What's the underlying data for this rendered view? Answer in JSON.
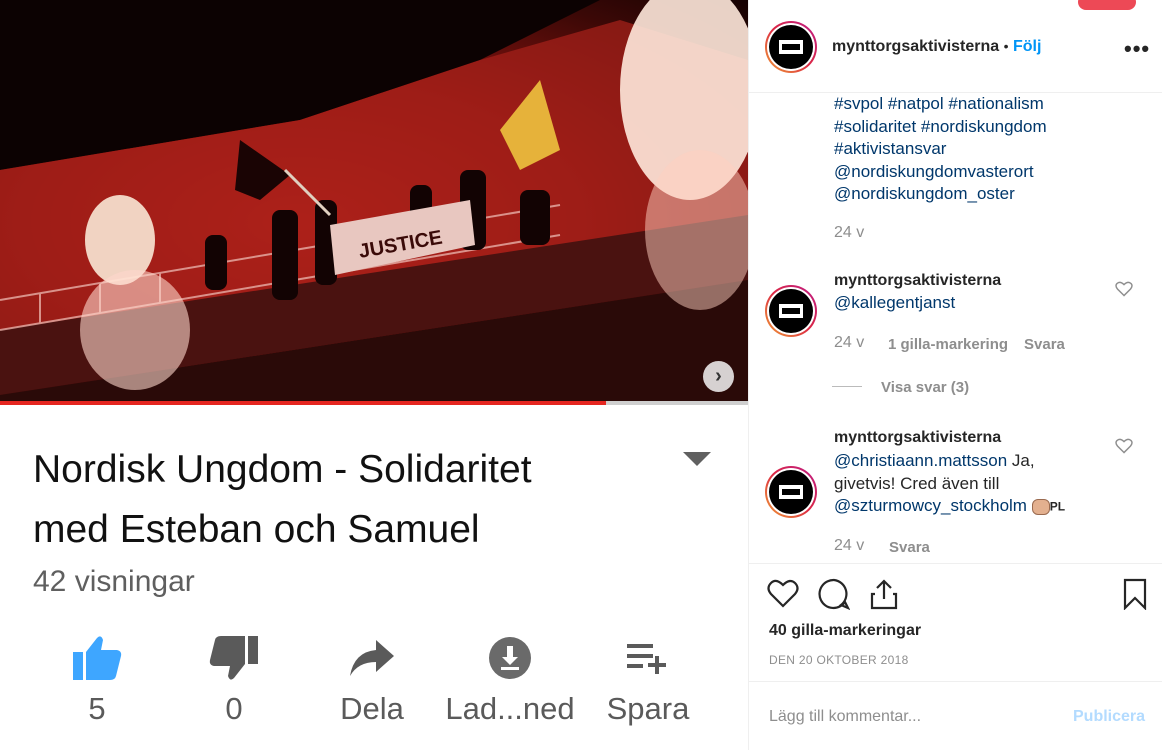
{
  "video": {
    "banner_text": "JUSTICE",
    "progress_fraction": 0.81,
    "next_label": "›"
  },
  "yt": {
    "title_line1": "Nordisk Ungdom - Solidaritet",
    "title_line2": "med Esteban och Samuel",
    "views": "42 visningar",
    "actions": [
      {
        "label": "5",
        "icon": "thumbs-up-icon"
      },
      {
        "label": "0",
        "icon": "thumbs-down-icon"
      },
      {
        "label": "Dela",
        "icon": "share-icon"
      },
      {
        "label": "Lad...ned",
        "icon": "download-icon"
      },
      {
        "label": "Spara",
        "icon": "add-to-playlist-icon"
      }
    ],
    "accent": "#3ea6ff"
  },
  "post": {
    "username": "mynttorgsaktivisterna",
    "separator": "•",
    "follow": "Följ",
    "more": "•••",
    "caption_lines": [
      "#svpol #natpol #nationalism",
      "#solidaritet #nordiskungdom",
      "#aktivistansvar",
      "@nordiskungdomvasterort",
      "@nordiskungdom_oster"
    ],
    "caption_age": "24 v",
    "comments": [
      {
        "user": "mynttorgsaktivisterna",
        "text": "@kallegentjanst",
        "age": "24 v",
        "likes": "1 gilla-markering",
        "reply": "Svara",
        "view_replies": "Visa svar (3)"
      },
      {
        "user": "mynttorgsaktivisterna",
        "mention1": "@christiaann.mattsson",
        "text_mid1": " Ja,",
        "text_mid2": "givetvis! Cred även till",
        "mention2": "@szturmowcy_stockholm",
        "emoji_text": "PL",
        "age": "24 v",
        "reply": "Svara"
      }
    ],
    "likes_count": "40 gilla-markeringar",
    "date": "DEN 20 OKTOBER 2018",
    "add_comment_placeholder": "Lägg till kommentar...",
    "publish": "Publicera",
    "link_color": "#00376b",
    "follow_color": "#0095f6"
  }
}
